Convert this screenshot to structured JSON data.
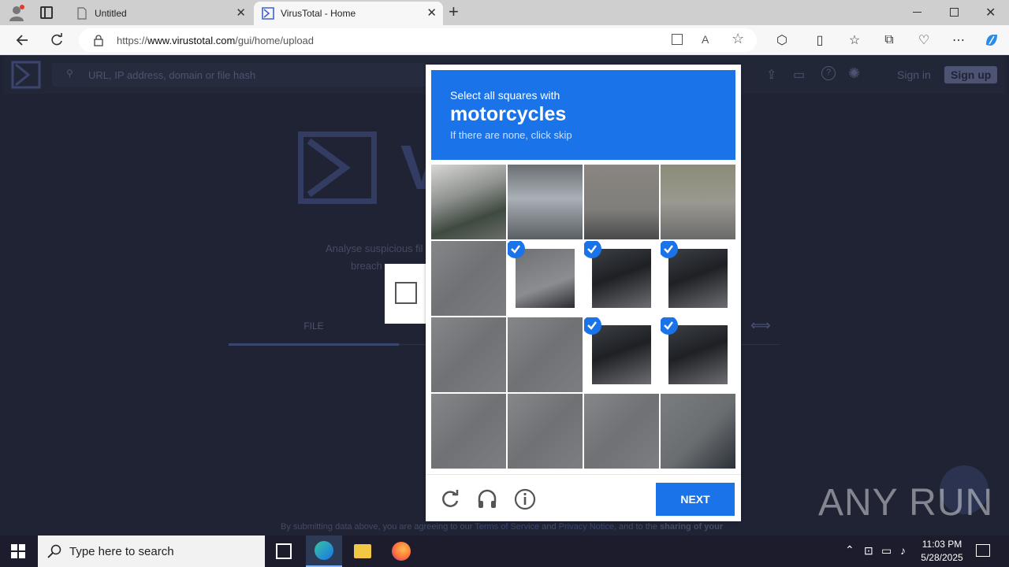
{
  "browser": {
    "tabs": [
      {
        "title": "Untitled",
        "active": false
      },
      {
        "title": "VirusTotal - Home",
        "active": true
      }
    ],
    "url_prefix": "https://",
    "url_host": "www.virustotal.com",
    "url_path": "/gui/home/upload"
  },
  "virustotal": {
    "search_placeholder": "URL, IP address, domain or file hash",
    "sign_in": "Sign in",
    "sign_up": "Sign up",
    "logo_partial": "V",
    "tagline_line1": "Analyse suspicious fil",
    "tagline_line2": "breach",
    "tab_file": "FILE",
    "footer_text_1": "By submitting data above, you are agreeing to our",
    "footer_terms": "Terms of Service",
    "footer_and": "and",
    "footer_privacy": "Privacy Notice",
    "footer_text_2": ", and to the",
    "footer_sharing": "sharing of your"
  },
  "captcha": {
    "instruction": "Select all squares with",
    "target": "motorcycles",
    "hint": "If there are none, click skip",
    "selected": [
      false,
      false,
      false,
      false,
      false,
      true,
      true,
      true,
      false,
      false,
      true,
      true,
      false,
      false,
      false,
      false
    ],
    "next_label": "NEXT"
  },
  "watermark": "ANY RUN",
  "taskbar": {
    "search_placeholder": "Type here to search",
    "time": "11:03 PM",
    "date": "5/28/2025"
  }
}
